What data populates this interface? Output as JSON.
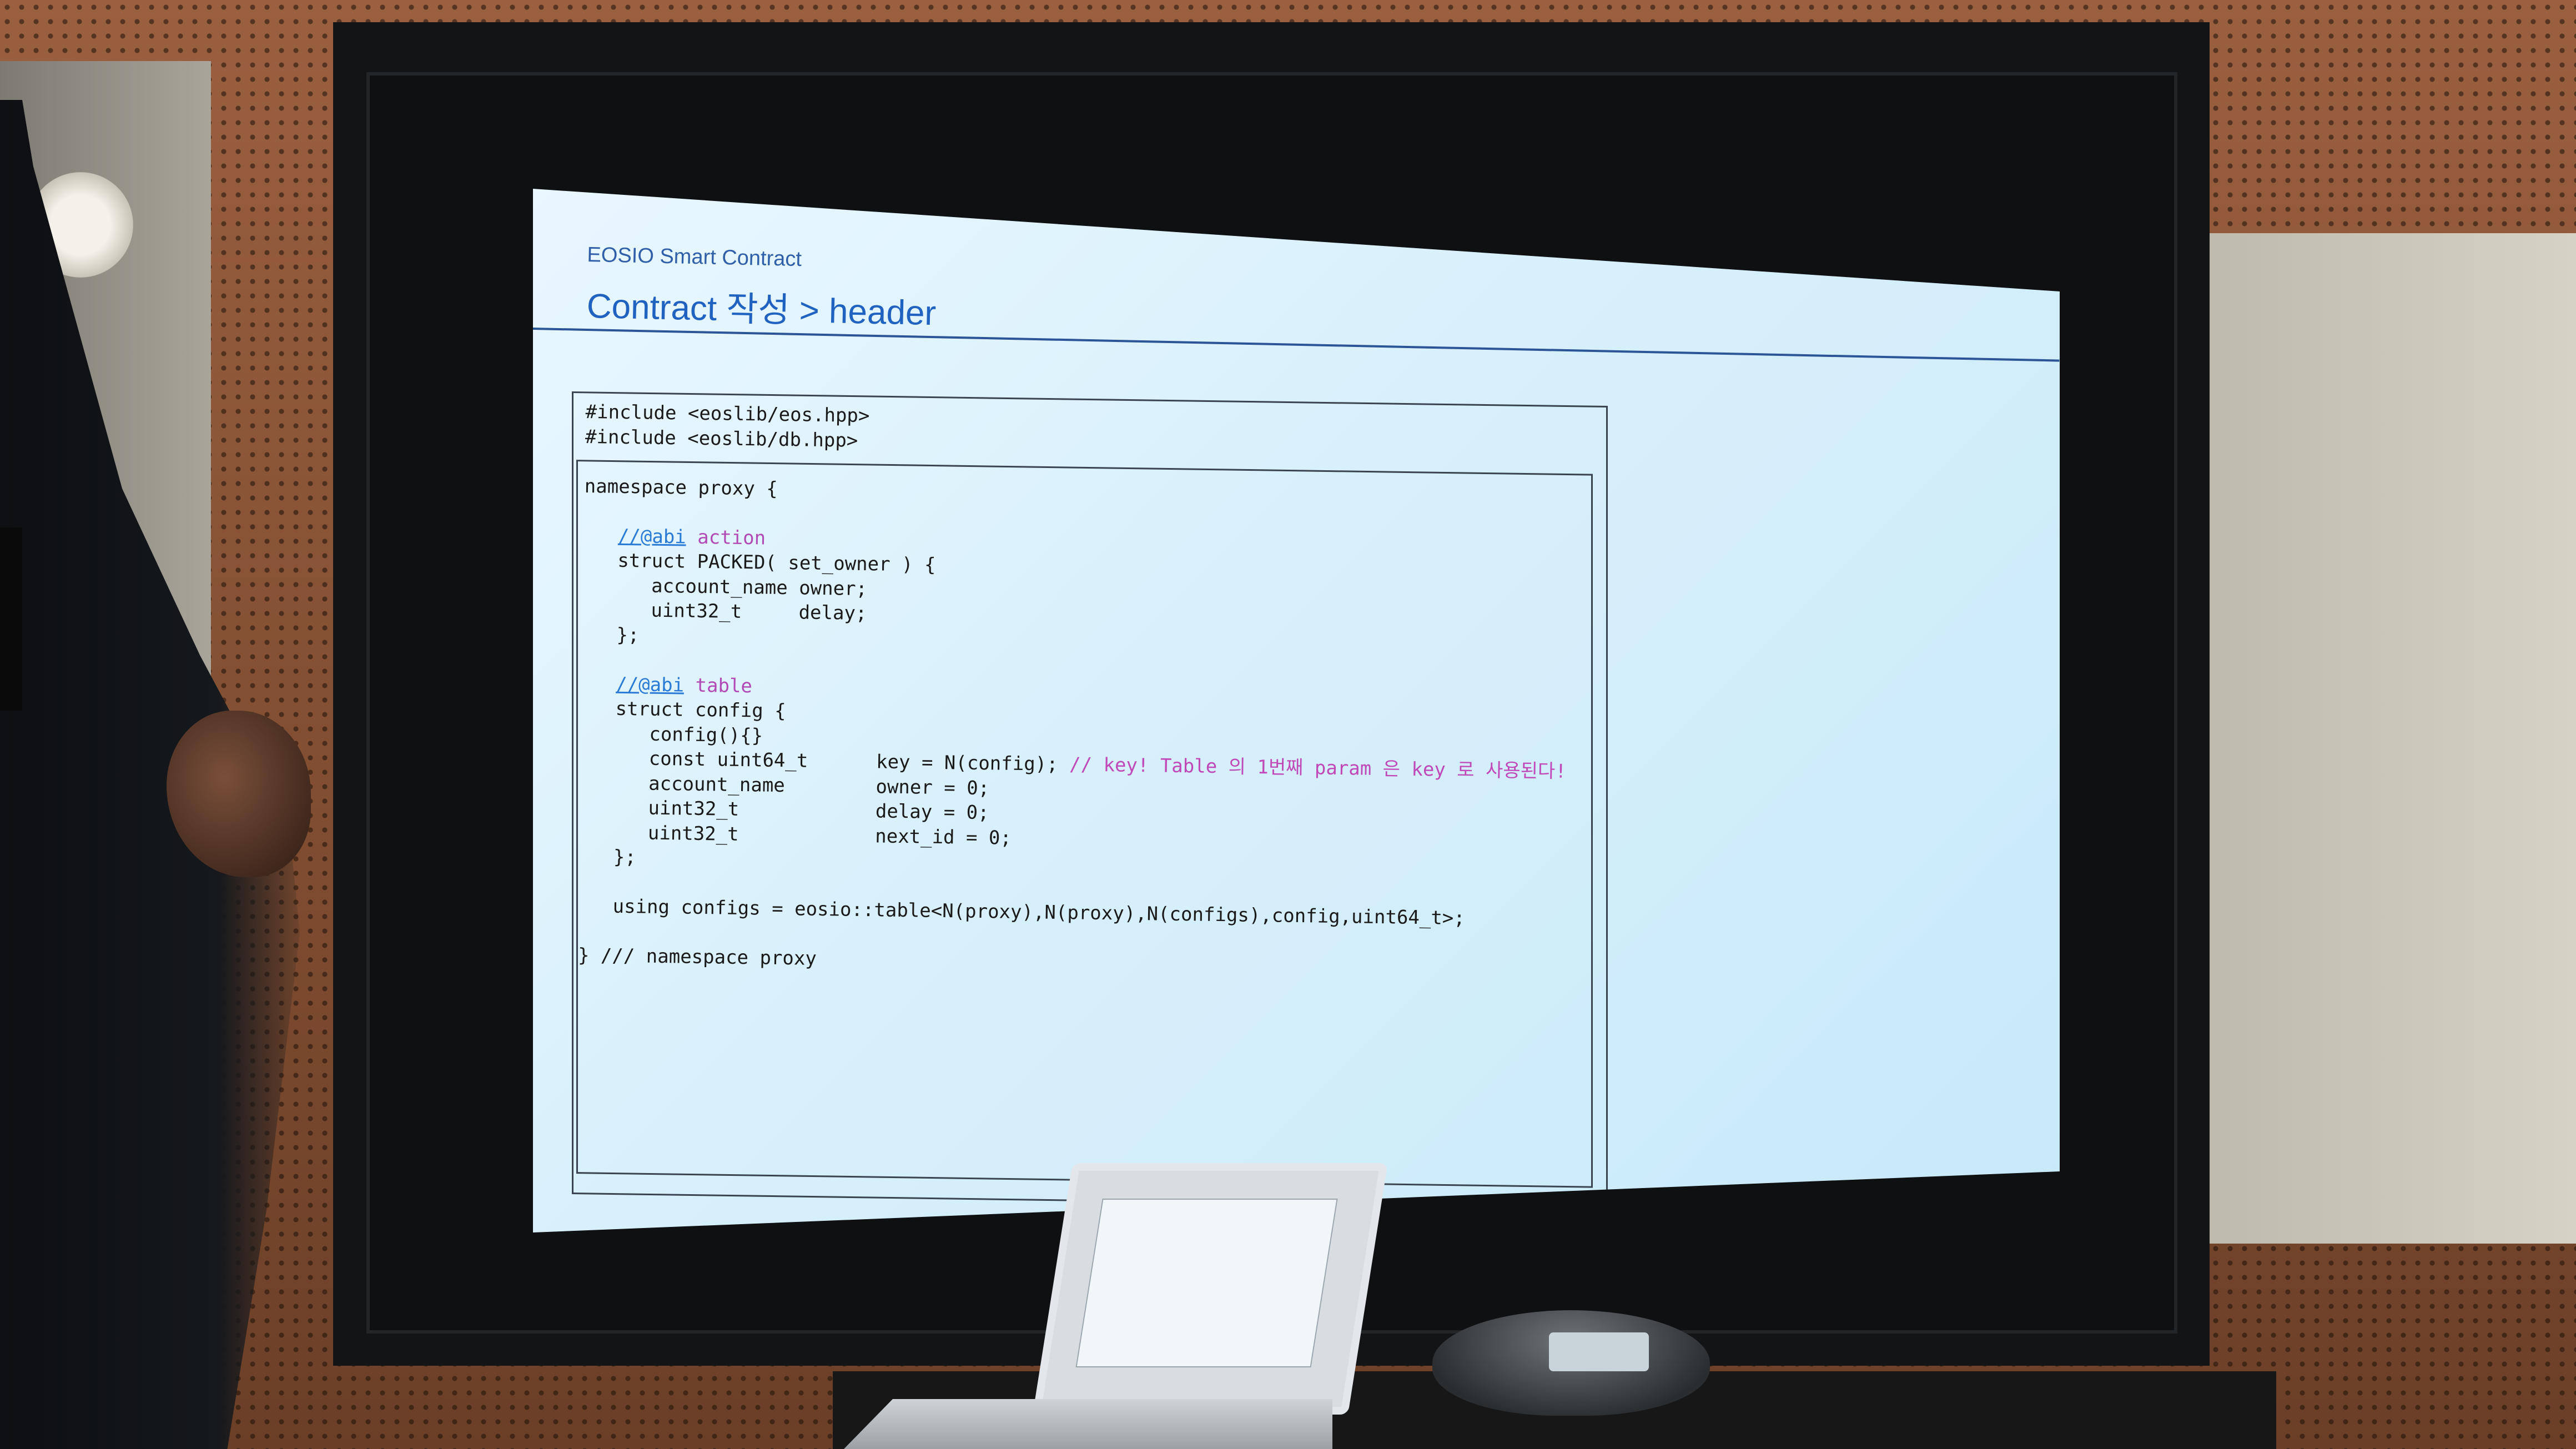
{
  "slide": {
    "subtitle": "EOSIO Smart Contract",
    "title": "Contract 작성 > header"
  },
  "code": {
    "line01": "#include <eoslib/eos.hpp>",
    "line02": "#include <eoslib/db.hpp>",
    "line03": "",
    "line04": "namespace proxy {",
    "line05": "",
    "line06_comment": "//@abi",
    "line06_kw": "action",
    "line07": "   struct PACKED( set_owner ) {",
    "line08": "      account_name owner;",
    "line09": "      uint32_t     delay;",
    "line10": "   };",
    "line11": "",
    "line12_comment": "//@abi",
    "line12_kw": "table",
    "line13": "   struct config {",
    "line14": "      config(){}",
    "line15_code": "      const uint64_t      key = N(config);",
    "line15_comment": "// key! Table 의 1번째 param 은 key 로 사용된다!",
    "line16": "      account_name        owner = 0;",
    "line17": "      uint32_t            delay = 0;",
    "line18": "      uint32_t            next_id = 0;",
    "line19": "   };",
    "line20": "",
    "line21": "   using configs = eosio::table<N(proxy),N(proxy),N(configs),config,uint64_t>;",
    "line22": "",
    "line23": "} /// namespace proxy"
  },
  "colors": {
    "slide_title": "#1f62c0",
    "code_comment": "#2a7bd6",
    "code_keyword": "#b24ab6",
    "screen_bg": "#d7f0fb"
  }
}
